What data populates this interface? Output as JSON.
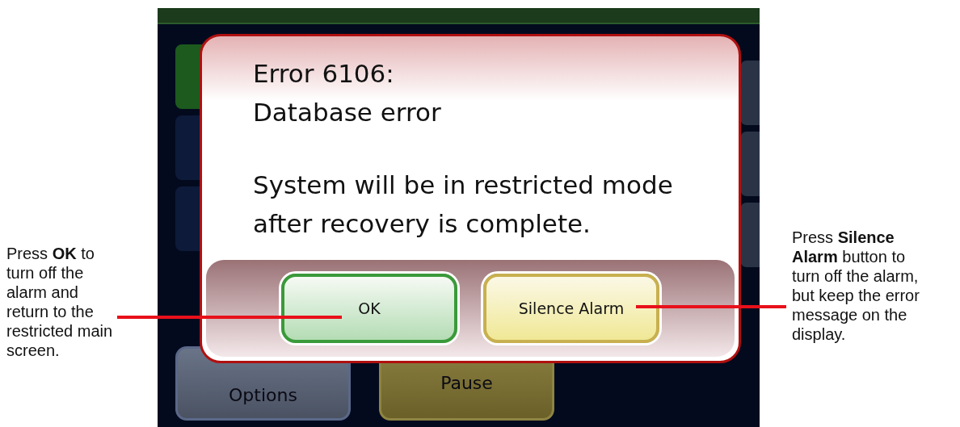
{
  "annotations": {
    "left_lines": [
      "Press **OK** to",
      "turn off the",
      "alarm and",
      "return to the",
      "restricted main",
      "screen."
    ],
    "right_lines": [
      "Press **Silence**",
      "**Alarm** button to",
      "turn off the alarm,",
      "but keep the error",
      "message on the",
      "display."
    ]
  },
  "screen": {
    "background_buttons": [
      {
        "label": "Options",
        "kind": "admin"
      },
      {
        "label": "Pause",
        "kind": "pause"
      }
    ]
  },
  "dialog": {
    "title_lines": [
      "Error 6106:",
      "Database error"
    ],
    "message_lines": [
      "System will be in restricted mode",
      "after recovery is complete."
    ],
    "buttons": [
      {
        "label": "OK",
        "kind": "ok"
      },
      {
        "label": "Silence Alarm",
        "kind": "silence"
      }
    ]
  }
}
